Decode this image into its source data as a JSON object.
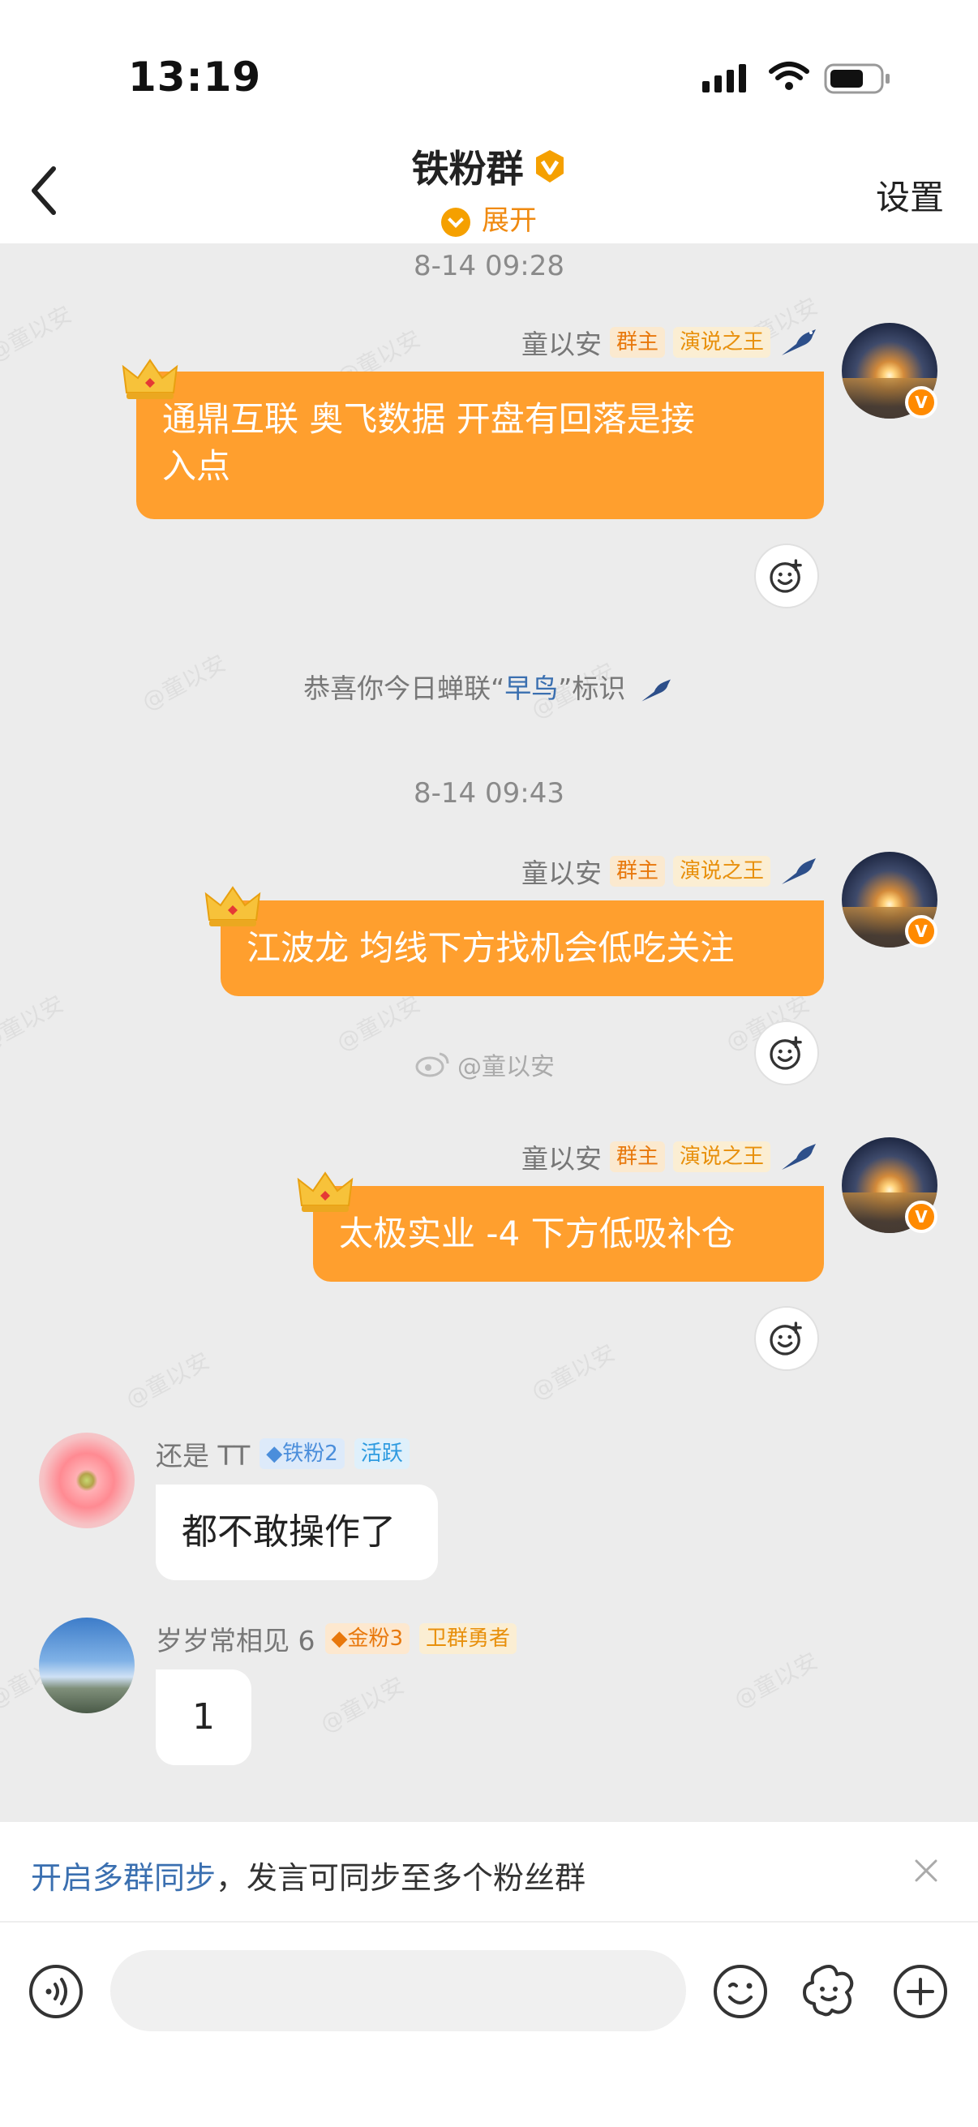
{
  "status_bar": {
    "time": "13:19"
  },
  "header": {
    "title": "铁粉群",
    "expand_label": "展开",
    "settings_label": "设置"
  },
  "watermark_text": "@童以安",
  "timestamps": [
    "8-14 09:28",
    "8-14 09:43"
  ],
  "messages_out": [
    {
      "sender": "童以安",
      "tags": [
        "群主",
        "演说之王"
      ],
      "text_line1": "通鼎互联  奥飞数据 开盘有回落是接",
      "text_line2": "入点"
    },
    {
      "sender": "童以安",
      "tags": [
        "群主",
        "演说之王"
      ],
      "text": "江波龙 均线下方找机会低吃关注"
    },
    {
      "sender": "童以安",
      "tags": [
        "群主",
        "演说之王"
      ],
      "text": "太极实业  -4 下方低吸补仓"
    }
  ],
  "system_notice": {
    "prefix": "恭喜你今日蝉联",
    "quote_open": "“",
    "highlight": "早鸟",
    "quote_close": "”",
    "suffix": "标识"
  },
  "weibo_mark": "@童以安",
  "messages_in": [
    {
      "sender": "还是 TT",
      "tags": [
        "铁粉2",
        "活跃"
      ],
      "text": "都不敢操作了"
    },
    {
      "sender": "岁岁常相见 6",
      "tags": [
        "金粉3",
        "卫群勇者"
      ],
      "text": "1"
    }
  ],
  "sync_bar": {
    "link_text": "开启多群同步",
    "rest_text": "，发言可同步至多个粉丝群"
  },
  "input": {
    "placeholder": ""
  },
  "colors": {
    "accent": "#ff9f2e",
    "link": "#3a6fb0",
    "background": "#ececec"
  },
  "icons": [
    "back-icon",
    "verified-icon",
    "chevron-down-icon",
    "crown-icon",
    "bird-icon",
    "add-reaction-icon",
    "voice-icon",
    "emoji-icon",
    "sticker-icon",
    "plus-icon",
    "close-icon"
  ]
}
